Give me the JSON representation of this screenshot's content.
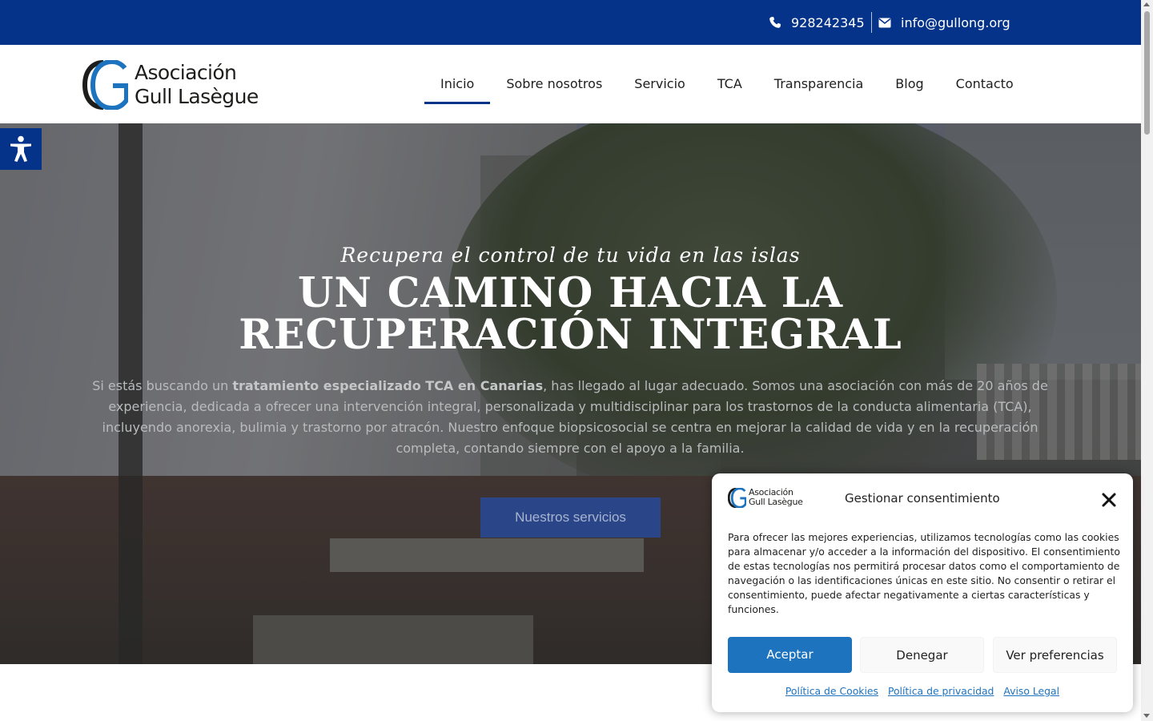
{
  "topbar": {
    "phone": "928242345",
    "email": "info@gullong.org",
    "phone_icon": "phone-icon",
    "email_icon": "envelope-icon",
    "background": "#05338a"
  },
  "header": {
    "logo_line1": "Asociación",
    "logo_line2": "Gull Lasègue",
    "nav": [
      {
        "label": "Inicio",
        "active": true
      },
      {
        "label": "Sobre nosotros",
        "active": false
      },
      {
        "label": "Servicio",
        "active": false
      },
      {
        "label": "TCA",
        "active": false
      },
      {
        "label": "Transparencia",
        "active": false
      },
      {
        "label": "Blog",
        "active": false
      },
      {
        "label": "Contacto",
        "active": false
      }
    ]
  },
  "accessibility": {
    "icon": "accessibility-icon"
  },
  "hero": {
    "tagline": "Recupera el control de tu vida en las islas",
    "title": "UN CAMINO HACIA LA RECUPERACIÓN INTEGRAL",
    "desc_before": "Si estás buscando un ",
    "desc_bold": "tratamiento especializado TCA en Canarias",
    "desc_after": ", has llegado al lugar adecuado. Somos una asociación con más de 20 años de experiencia, dedicada a ofrecer una intervención integral, personalizada y multidisciplinar para los trastornos de la conducta alimentaria (TCA), incluyendo anorexia, bulimia y trastorno por atracón. Nuestro enfoque biopsicosocial se centra en mejorar la calidad de vida y en la recuperación completa, contando siempre con el apoyo a la familia.",
    "cta_label": "Nuestros servicios"
  },
  "consent": {
    "logo_line1": "Asociación",
    "logo_line2": "Gull Lasègue",
    "title": "Gestionar consentimiento",
    "body": "Para ofrecer las mejores experiencias, utilizamos tecnologías como las cookies para almacenar y/o acceder a la información del dispositivo. El consentimiento de estas tecnologías nos permitirá procesar datos como el comportamiento de navegación o las identificaciones únicas en este sitio. No consentir o retirar el consentimiento, puede afectar negativamente a ciertas características y funciones.",
    "accept_label": "Aceptar",
    "deny_label": "Denegar",
    "prefs_label": "Ver preferencias",
    "links": [
      "Política de Cookies",
      "Política de privacidad",
      "Aviso Legal"
    ],
    "accent": "#1e73be"
  }
}
